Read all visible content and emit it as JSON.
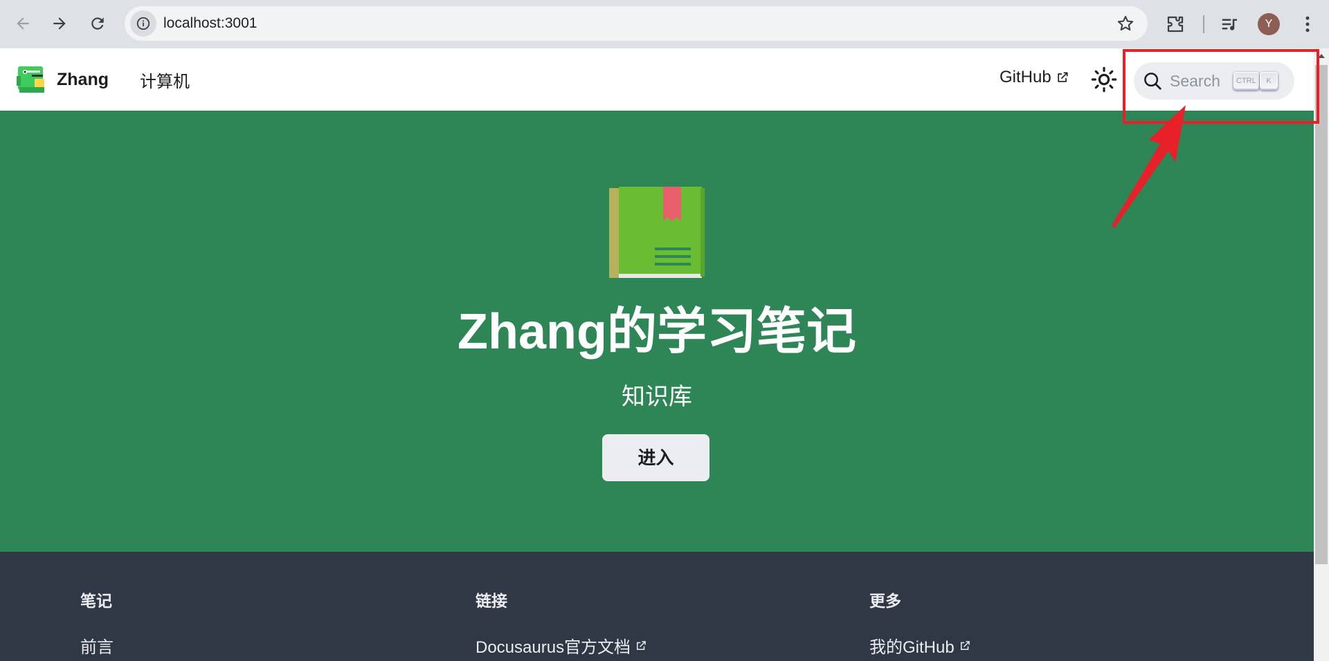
{
  "browser": {
    "url": "localhost:3001",
    "avatar_letter": "Y"
  },
  "navbar": {
    "brand_title": "Zhang",
    "nav_link": "计算机",
    "github_link": "GitHub",
    "search_placeholder": "Search",
    "search_shortcut": [
      "CTRL",
      "K"
    ]
  },
  "hero": {
    "title": "Zhang的学习笔记",
    "subtitle": "知识库",
    "button_label": "进入"
  },
  "footer": {
    "columns": [
      {
        "title": "笔记",
        "link": "前言"
      },
      {
        "title": "链接",
        "link": "Docusaurus官方文档"
      },
      {
        "title": "更多",
        "link": "我的GitHub"
      }
    ]
  },
  "colors": {
    "primary": "#2e8555",
    "footer_bg": "#303846",
    "annotation": "#e8202a"
  }
}
